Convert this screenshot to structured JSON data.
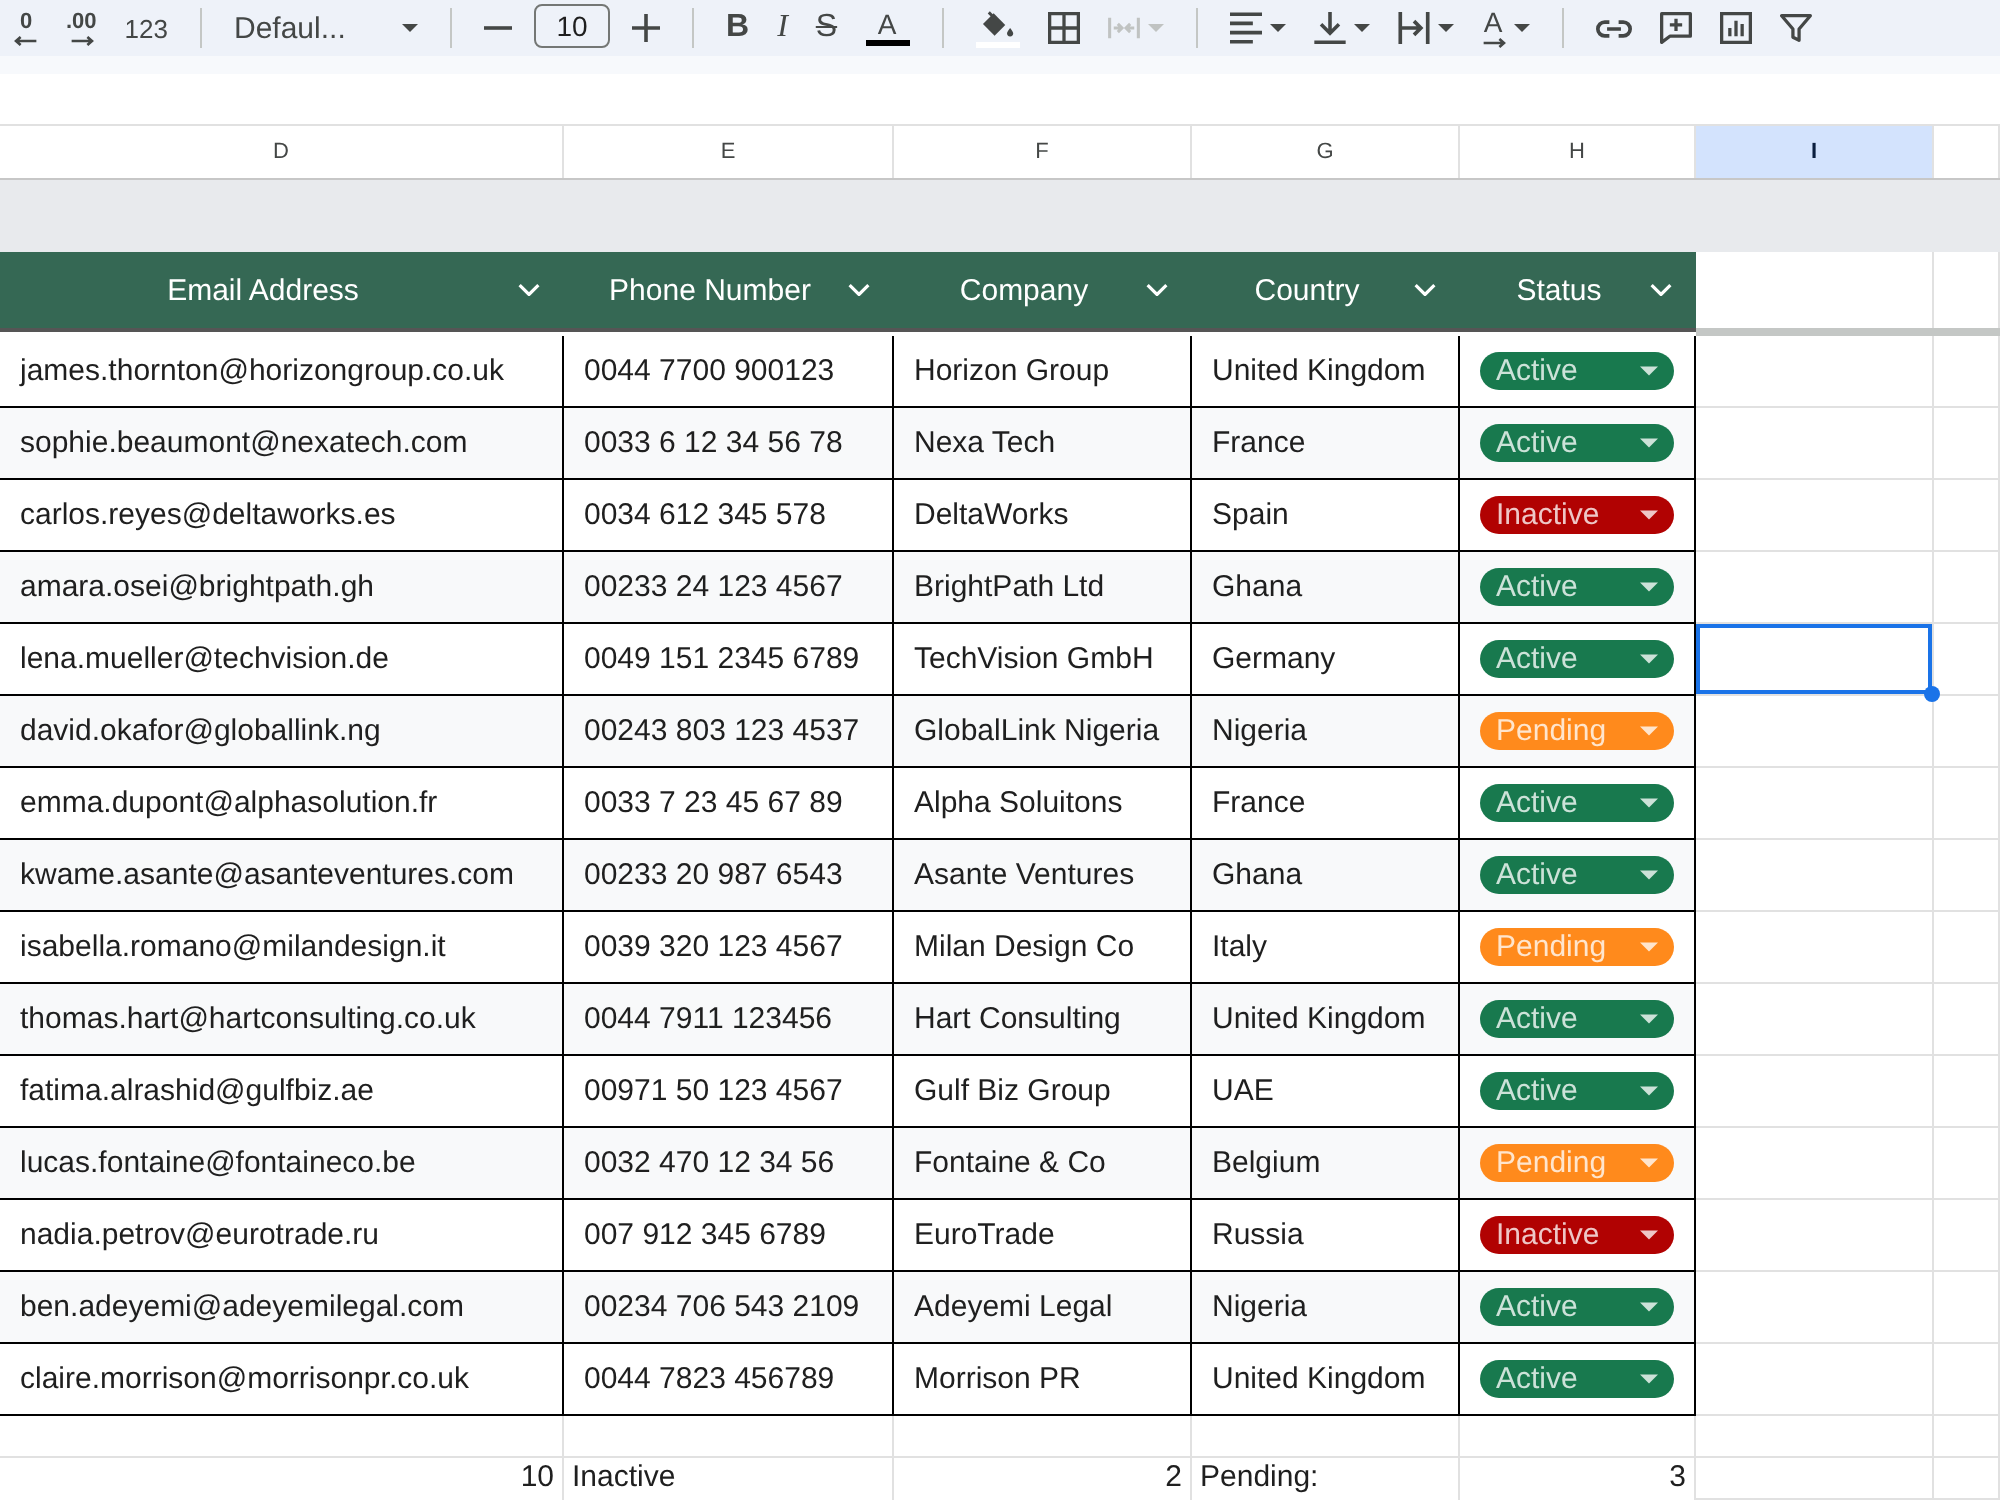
{
  "toolbar": {
    "groups": [
      [
        {
          "kind": "decrease-decimal",
          "label": "0",
          "disabled": false,
          "dropdown": false
        },
        {
          "kind": "increase-decimal",
          "label": ".00",
          "disabled": false,
          "dropdown": false
        },
        {
          "kind": "number-format",
          "label": "123",
          "disabled": false,
          "dropdown": false
        }
      ],
      [
        {
          "kind": "font",
          "label": "Defaul...",
          "disabled": false,
          "dropdown": true
        }
      ],
      [
        {
          "kind": "decrease-size",
          "disabled": false,
          "dropdown": false
        },
        {
          "kind": "size",
          "label": "10",
          "disabled": false,
          "dropdown": false
        },
        {
          "kind": "increase-size",
          "disabled": false,
          "dropdown": false
        }
      ],
      [
        {
          "kind": "bold",
          "label": "B",
          "disabled": false,
          "dropdown": false
        },
        {
          "kind": "italic",
          "label": "I",
          "disabled": false,
          "dropdown": false
        },
        {
          "kind": "strike",
          "label": "S",
          "disabled": false,
          "dropdown": false
        },
        {
          "kind": "text-color",
          "label": "A",
          "color": "#000000",
          "disabled": false,
          "dropdown": false
        }
      ],
      [
        {
          "kind": "fill",
          "color": "#ffffff",
          "disabled": false,
          "dropdown": false
        },
        {
          "kind": "borders",
          "disabled": false,
          "dropdown": false
        },
        {
          "kind": "merge",
          "disabled": true,
          "dropdown": true
        }
      ],
      [
        {
          "kind": "align",
          "disabled": false,
          "dropdown": true
        },
        {
          "kind": "valign",
          "disabled": false,
          "dropdown": true
        },
        {
          "kind": "wrap",
          "disabled": false,
          "dropdown": true
        },
        {
          "kind": "rotate",
          "label": "A",
          "disabled": false,
          "dropdown": true
        }
      ],
      [
        {
          "kind": "link",
          "disabled": false,
          "dropdown": false
        },
        {
          "kind": "comment",
          "disabled": false,
          "dropdown": false
        },
        {
          "kind": "chart",
          "disabled": false,
          "dropdown": false
        },
        {
          "kind": "filter",
          "disabled": false,
          "dropdown": false
        }
      ]
    ]
  },
  "sheet": {
    "column_headers": [
      {
        "label": "D",
        "selected": false
      },
      {
        "label": "E",
        "selected": false
      },
      {
        "label": "F",
        "selected": false
      },
      {
        "label": "G",
        "selected": false
      },
      {
        "label": "H",
        "selected": false
      },
      {
        "label": "I",
        "selected": true
      }
    ],
    "table": {
      "columns": [
        "Email Address",
        "Phone Number",
        "Company",
        "Country",
        "Status"
      ],
      "rows": [
        {
          "cells": [
            "james.thornton@horizongroup.co.uk",
            "0044 7700 900123",
            "Horizon Group",
            "United Kingdom"
          ],
          "status": {
            "label": "Active",
            "color": "#18794e"
          },
          "i_cell_selected": false
        },
        {
          "cells": [
            "sophie.beaumont@nexatech.com",
            "0033 6 12 34 56 78",
            "Nexa Tech",
            "France"
          ],
          "status": {
            "label": "Active",
            "color": "#18794e"
          },
          "i_cell_selected": false
        },
        {
          "cells": [
            "carlos.reyes@deltaworks.es",
            "0034 612 345 578",
            "DeltaWorks",
            "Spain"
          ],
          "status": {
            "label": "Inactive",
            "color": "#b10202"
          },
          "i_cell_selected": false
        },
        {
          "cells": [
            "amara.osei@brightpath.gh",
            "00233 24 123 4567",
            "BrightPath Ltd",
            "Ghana"
          ],
          "status": {
            "label": "Active",
            "color": "#18794e"
          },
          "i_cell_selected": false
        },
        {
          "cells": [
            "lena.mueller@techvision.de",
            "0049 151 2345 6789",
            "TechVision GmbH",
            "Germany"
          ],
          "status": {
            "label": "Active",
            "color": "#18794e"
          },
          "i_cell_selected": true
        },
        {
          "cells": [
            "david.okafor@globallink.ng",
            "00243 803 123 4537",
            "GlobalLink Nigeria",
            "Nigeria"
          ],
          "status": {
            "label": "Pending",
            "color": "#ff8a1c"
          },
          "i_cell_selected": false
        },
        {
          "cells": [
            "emma.dupont@alphasolution.fr",
            "0033 7 23 45 67 89",
            "Alpha Soluitons",
            "France"
          ],
          "status": {
            "label": "Active",
            "color": "#18794e"
          },
          "i_cell_selected": false
        },
        {
          "cells": [
            "kwame.asante@asanteventures.com",
            "00233 20 987 6543",
            "Asante Ventures",
            "Ghana"
          ],
          "status": {
            "label": "Active",
            "color": "#18794e"
          },
          "i_cell_selected": false
        },
        {
          "cells": [
            "isabella.romano@milandesign.it",
            "0039 320 123 4567",
            "Milan Design Co",
            "Italy"
          ],
          "status": {
            "label": "Pending",
            "color": "#ff8a1c"
          },
          "i_cell_selected": false
        },
        {
          "cells": [
            "thomas.hart@hartconsulting.co.uk",
            "0044 7911 123456",
            "Hart Consulting",
            "United Kingdom"
          ],
          "status": {
            "label": "Active",
            "color": "#18794e"
          },
          "i_cell_selected": false
        },
        {
          "cells": [
            "fatima.alrashid@gulfbiz.ae",
            "00971 50 123 4567",
            "Gulf Biz Group",
            "UAE"
          ],
          "status": {
            "label": "Active",
            "color": "#18794e"
          },
          "i_cell_selected": false
        },
        {
          "cells": [
            "lucas.fontaine@fontaineco.be",
            "0032 470 12 34 56",
            "Fontaine & Co",
            "Belgium"
          ],
          "status": {
            "label": "Pending",
            "color": "#ff8a1c"
          },
          "i_cell_selected": false
        },
        {
          "cells": [
            "nadia.petrov@eurotrade.ru",
            "007 912 345 6789",
            "EuroTrade",
            "Russia"
          ],
          "status": {
            "label": "Inactive",
            "color": "#b10202"
          },
          "i_cell_selected": false
        },
        {
          "cells": [
            "ben.adeyemi@adeyemilegal.com",
            "00234 706 543 2109",
            "Adeyemi Legal",
            "Nigeria"
          ],
          "status": {
            "label": "Active",
            "color": "#18794e"
          },
          "i_cell_selected": false
        },
        {
          "cells": [
            "claire.morrison@morrisonpr.co.uk",
            "0044 7823 456789",
            "Morrison PR",
            "United Kingdom"
          ],
          "status": {
            "label": "Active",
            "color": "#18794e"
          },
          "i_cell_selected": false
        }
      ]
    },
    "summary": [
      {
        "kind": "count",
        "text": "10"
      },
      {
        "kind": "label",
        "text": "Inactive"
      },
      {
        "kind": "count",
        "text": "2"
      },
      {
        "kind": "label",
        "text": "Pending:"
      },
      {
        "kind": "count",
        "text": "3"
      }
    ]
  }
}
